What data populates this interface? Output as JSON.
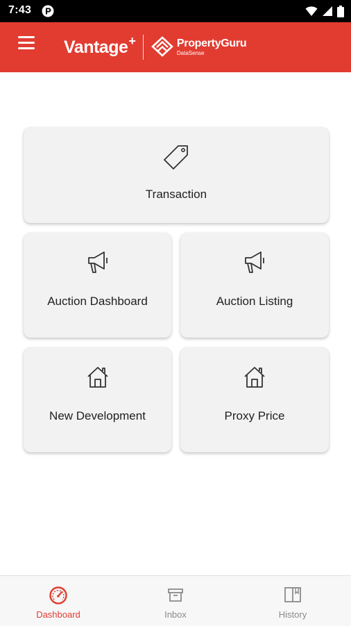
{
  "status_bar": {
    "time": "7:43",
    "icons": [
      "app-notification-icon",
      "wifi-icon",
      "signal-icon",
      "battery-icon"
    ]
  },
  "header": {
    "brand_vantage": "Vantage",
    "brand_plus": "+",
    "brand_partner": "PropertyGuru",
    "brand_partner_sub": "DataSense",
    "colors": {
      "header_bg": "#e23c31",
      "accent": "#e23c31"
    }
  },
  "menu": {
    "transaction": {
      "label": "Transaction",
      "icon": "tag-icon"
    },
    "auction_dashboard": {
      "label": "Auction Dashboard",
      "icon": "megaphone-icon"
    },
    "auction_listing": {
      "label": "Auction Listing",
      "icon": "megaphone-icon"
    },
    "new_development": {
      "label": "New Development",
      "icon": "house-icon"
    },
    "proxy_price": {
      "label": "Proxy Price",
      "icon": "house-icon"
    }
  },
  "bottom_nav": {
    "dashboard": {
      "label": "Dashboard",
      "icon": "speedometer-icon",
      "active": true
    },
    "inbox": {
      "label": "Inbox",
      "icon": "archive-box-icon",
      "active": false
    },
    "history": {
      "label": "History",
      "icon": "book-icon",
      "active": false
    },
    "colors": {
      "active": "#e23c31",
      "inactive": "#8a8a8a"
    }
  }
}
